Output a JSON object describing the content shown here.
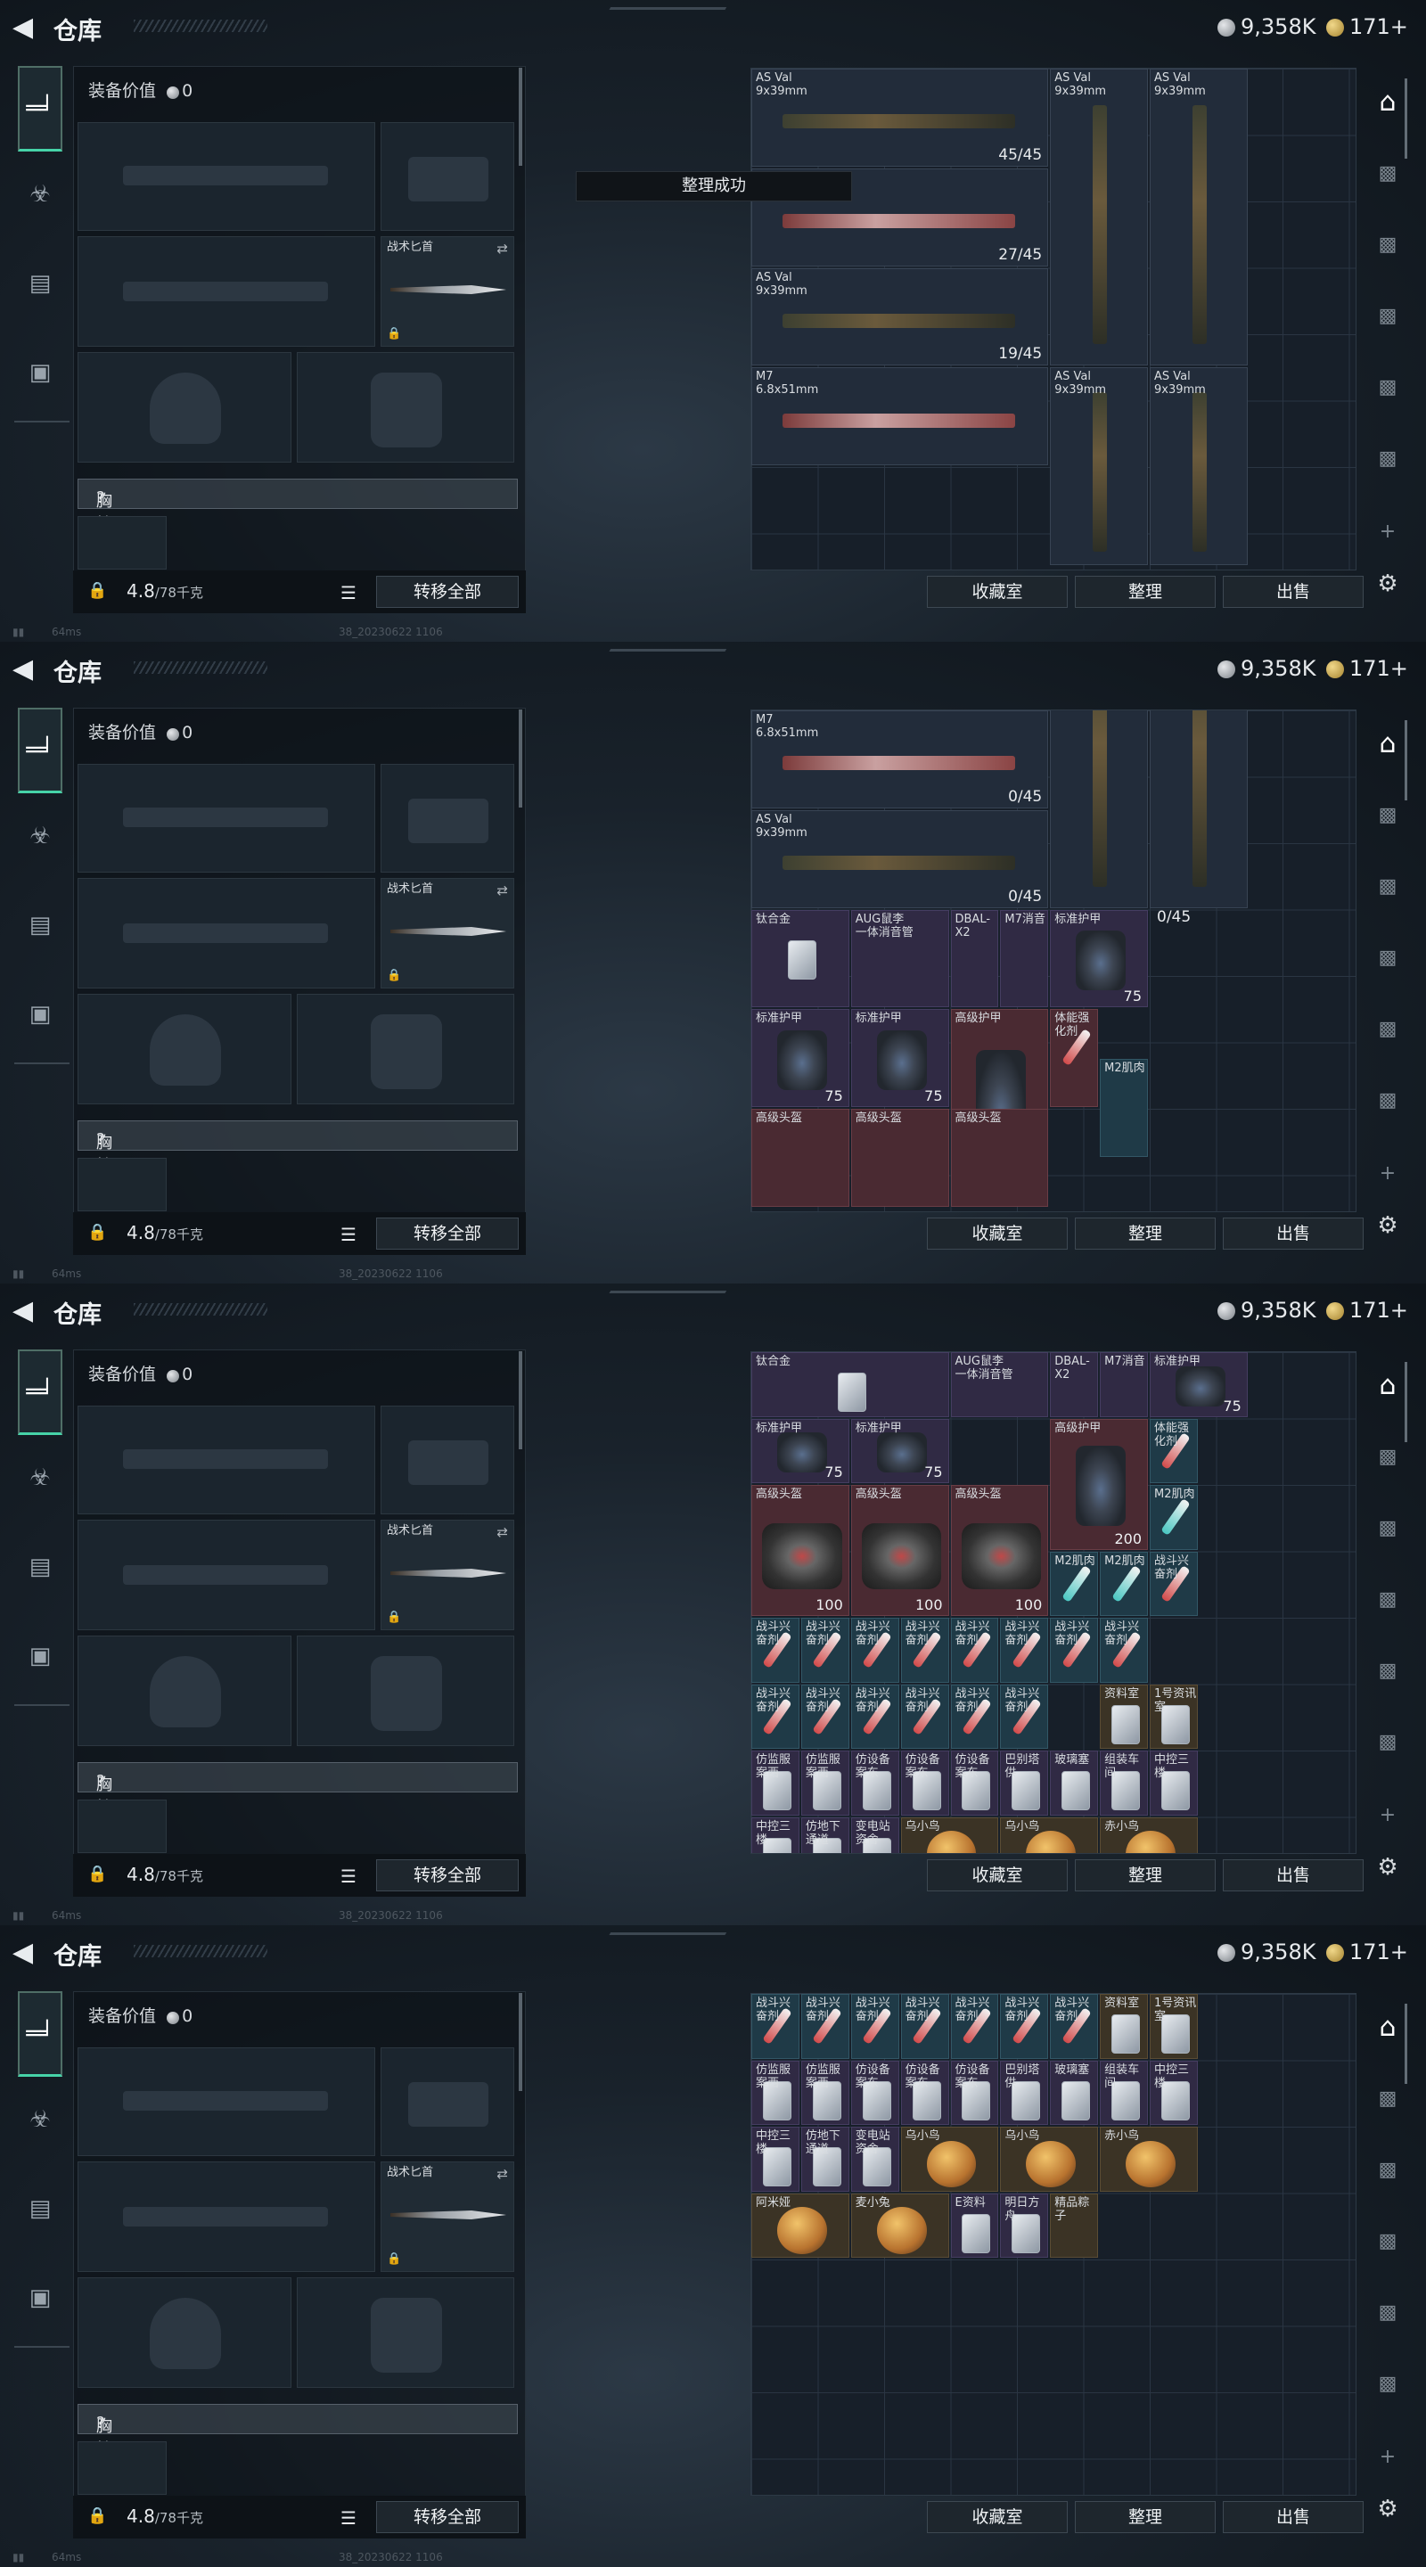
{
  "header": {
    "title": "仓库",
    "silver": "9,358K",
    "gold": "171+"
  },
  "left": {
    "equip_value_label": "装备价值",
    "equip_value": "0",
    "knife_label": "战术匕首",
    "chest_label": "胸挂",
    "chest_q": "?",
    "weight": "4.8",
    "capacity": "/78千克",
    "transfer_all": "转移全部"
  },
  "toast": "整理成功",
  "buttons": {
    "collection": "收藏室",
    "sort": "整理",
    "sell": "出售"
  },
  "footer": {
    "ping": "64ms",
    "build": "38_20230622 1106"
  },
  "p1": {
    "items": [
      {
        "name": "AS Val\n9x39mm",
        "count": "45/45"
      },
      {
        "name": "AS Val\n9x39mm"
      },
      {
        "name": "AS Val\n9x39mm"
      },
      {
        "name": "M7\n6.8x51mm",
        "count": "27/45"
      },
      {
        "name": "AS Val\n9x39mm",
        "count": "19/45"
      },
      {
        "count": "0/45"
      },
      {
        "count": "0/45"
      },
      {
        "name": "AS Val\n9x39mm"
      },
      {
        "name": "AS Val\n9x39mm"
      },
      {
        "name": "M7\n6.8x51mm"
      }
    ]
  },
  "p2": {
    "items": [
      {
        "count": "19/45"
      },
      {
        "name": "AS Val\n9x39mm"
      },
      {
        "name": "AS Val\n9x39mm"
      },
      {
        "name": "M7\n6.8x51mm",
        "count": "0/45"
      },
      {
        "name": "AS Val\n9x39mm",
        "count": "0/45"
      },
      {
        "count": "0/45"
      },
      {
        "count": "0/45"
      },
      {
        "name": "钛合金"
      },
      {
        "name": "AUG鼠李\n一体消音管"
      },
      {
        "name": "DBAL-X2"
      },
      {
        "name": "M7消音"
      },
      {
        "name": "标准护甲",
        "dur": "75"
      },
      {
        "name": "标准护甲",
        "dur": "75"
      },
      {
        "name": "标准护甲",
        "dur": "75"
      },
      {
        "name": "高级护甲"
      },
      {
        "name": "体能强化剂"
      },
      {
        "name": "高级头盔"
      },
      {
        "name": "高级头盔"
      },
      {
        "name": "高级头盔"
      },
      {
        "name": "M2肌肉"
      }
    ]
  },
  "p3": {
    "items": [
      {
        "name": "钛合金"
      },
      {
        "name": "AUG鼠李\n一体消音管"
      },
      {
        "name": "DBAL-X2"
      },
      {
        "name": "M7消音"
      },
      {
        "name": "标准护甲",
        "dur": "75"
      },
      {
        "name": "标准护甲",
        "dur": "75"
      },
      {
        "name": "标准护甲",
        "dur": "75"
      },
      {
        "name": "高级护甲",
        "dur": "200"
      },
      {
        "name": "体能强化剂"
      },
      {
        "name": "高级头盔",
        "dur": "100"
      },
      {
        "name": "高级头盔",
        "dur": "100"
      },
      {
        "name": "高级头盔",
        "dur": "100"
      },
      {
        "name": "M2肌肉"
      },
      {
        "name": "M2肌肉"
      },
      {
        "name": "M2肌肉"
      },
      {
        "name": "战斗兴奋剂"
      },
      {
        "name": "战斗兴奋剂"
      },
      {
        "name": "战斗兴奋剂"
      },
      {
        "name": "战斗兴奋剂"
      },
      {
        "name": "战斗兴奋剂"
      },
      {
        "name": "战斗兴奋剂"
      },
      {
        "name": "战斗兴奋剂"
      },
      {
        "name": "战斗兴奋剂"
      },
      {
        "name": "战斗兴奋剂"
      },
      {
        "name": "战斗兴奋剂"
      },
      {
        "name": "战斗兴奋剂"
      },
      {
        "name": "战斗兴奋剂"
      },
      {
        "name": "战斗兴奋剂"
      },
      {
        "name": "战斗兴奋剂"
      },
      {
        "name": "战斗兴奋剂"
      },
      {
        "name": "资料室"
      },
      {
        "name": "1号资讯室"
      },
      {
        "name": "仿监服案西"
      },
      {
        "name": "仿监服案西"
      },
      {
        "name": "仿设备案东"
      },
      {
        "name": "仿设备案东"
      },
      {
        "name": "仿设备案东"
      },
      {
        "name": "巴别塔供"
      },
      {
        "name": "玻璃塞"
      },
      {
        "name": "组装车间"
      },
      {
        "name": "中控三楼"
      },
      {
        "name": "中控三楼"
      },
      {
        "name": "仿地下通道"
      },
      {
        "name": "变电站资舍"
      },
      {
        "name": "乌小鸟"
      },
      {
        "name": "乌小鸟"
      },
      {
        "name": "赤小鸟"
      }
    ]
  },
  "p4": {
    "items": [
      {
        "name": "战斗兴奋剂"
      },
      {
        "name": "战斗兴奋剂"
      },
      {
        "name": "战斗兴奋剂"
      },
      {
        "name": "战斗兴奋剂"
      },
      {
        "name": "战斗兴奋剂"
      },
      {
        "name": "战斗兴奋剂"
      },
      {
        "name": "战斗兴奋剂"
      },
      {
        "name": "资料室"
      },
      {
        "name": "1号资讯室"
      },
      {
        "name": "仿监服案西"
      },
      {
        "name": "仿监服案西"
      },
      {
        "name": "仿设备案东"
      },
      {
        "name": "仿设备案东"
      },
      {
        "name": "仿设备案东"
      },
      {
        "name": "巴别塔供"
      },
      {
        "name": "玻璃塞"
      },
      {
        "name": "组装车间"
      },
      {
        "name": "中控三楼"
      },
      {
        "name": "中控三楼"
      },
      {
        "name": "仿地下通道"
      },
      {
        "name": "变电站资舍"
      },
      {
        "name": "乌小鸟"
      },
      {
        "name": "乌小鸟"
      },
      {
        "name": "赤小鸟"
      },
      {
        "name": "阿米娅"
      },
      {
        "name": "麦小兔"
      },
      {
        "name": "E资料"
      },
      {
        "name": "明日方舟"
      },
      {
        "name": "精品粽子"
      }
    ]
  }
}
